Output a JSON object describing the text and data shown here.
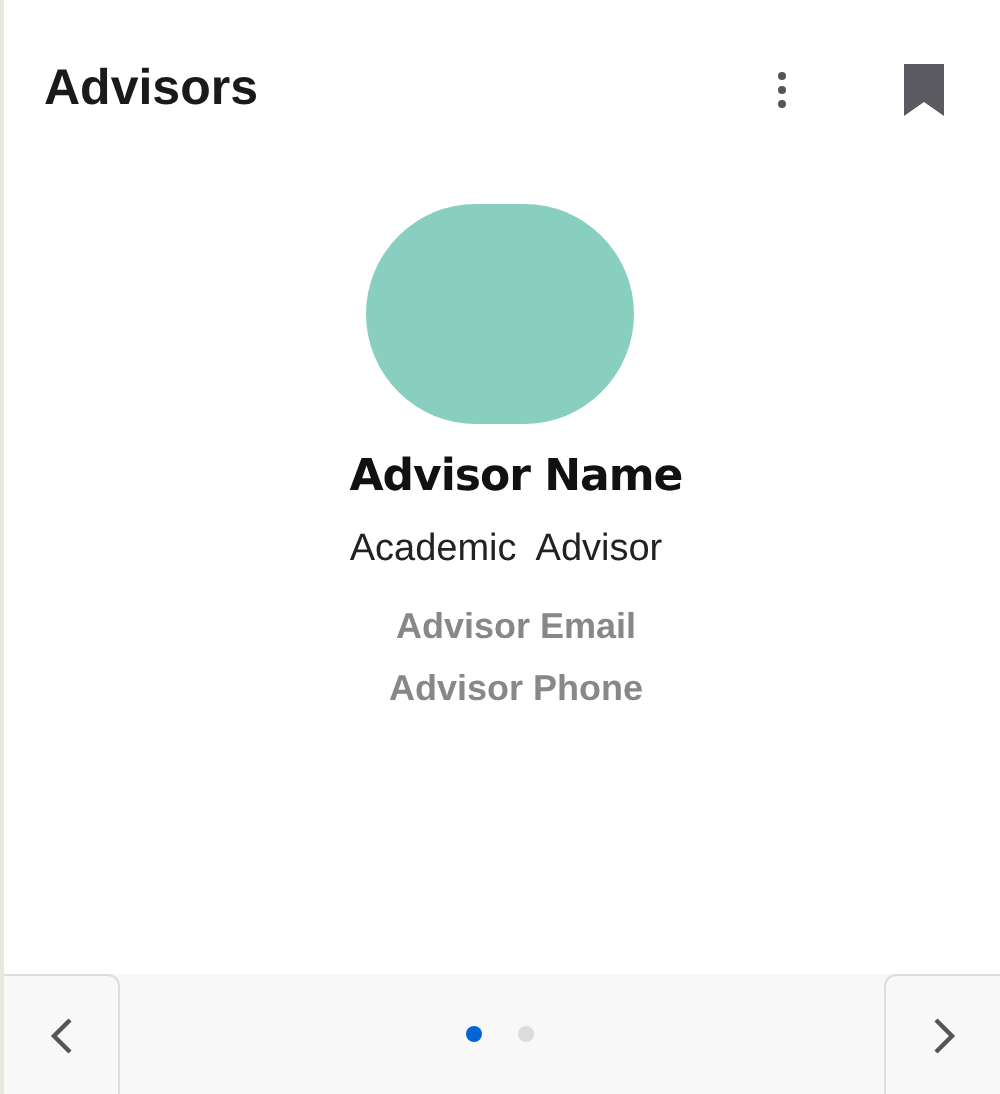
{
  "header": {
    "title": "Advisors"
  },
  "advisor": {
    "name": "Advisor Name",
    "role": "Academic  Advisor",
    "email": "Advisor Email",
    "phone": "Advisor Phone"
  },
  "pager": {
    "dots": [
      {
        "selected": true
      },
      {
        "selected": false
      }
    ]
  }
}
